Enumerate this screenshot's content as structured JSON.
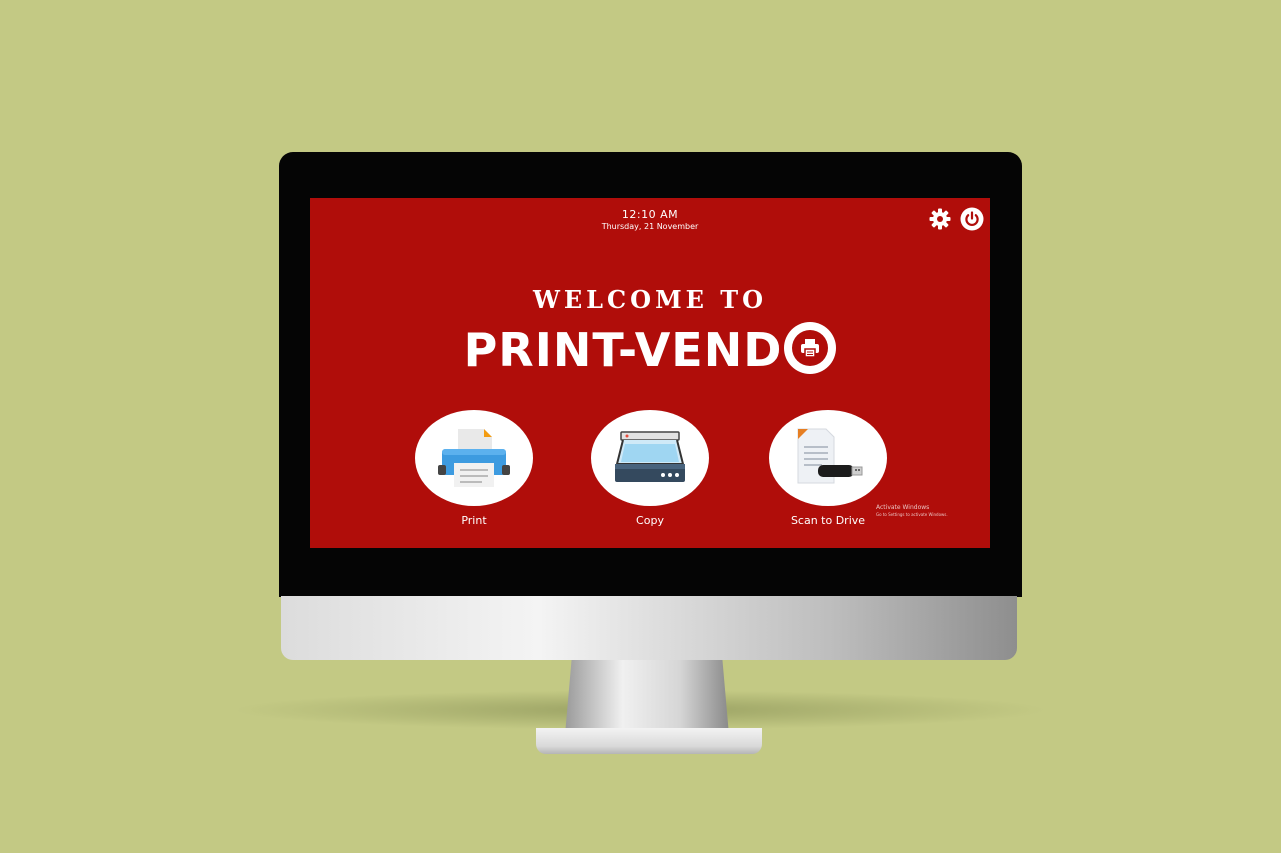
{
  "screen": {
    "time": "12:10 AM",
    "date": "Thursday, 21 November",
    "welcome": "WELCOME TO",
    "brand": "PRINT-VEND",
    "options": [
      {
        "label": "Print",
        "icon": "printer-icon"
      },
      {
        "label": "Copy",
        "icon": "scanner-icon"
      },
      {
        "label": "Scan to Drive",
        "icon": "usb-drive-icon"
      }
    ],
    "top_icons": [
      "gear-icon",
      "power-icon"
    ],
    "watermark": {
      "title": "Activate Windows",
      "subtitle": "Go to Settings to activate Windows."
    }
  },
  "colors": {
    "background": "#c3c984",
    "screen": "#b00d0a",
    "text": "#ffffff"
  }
}
